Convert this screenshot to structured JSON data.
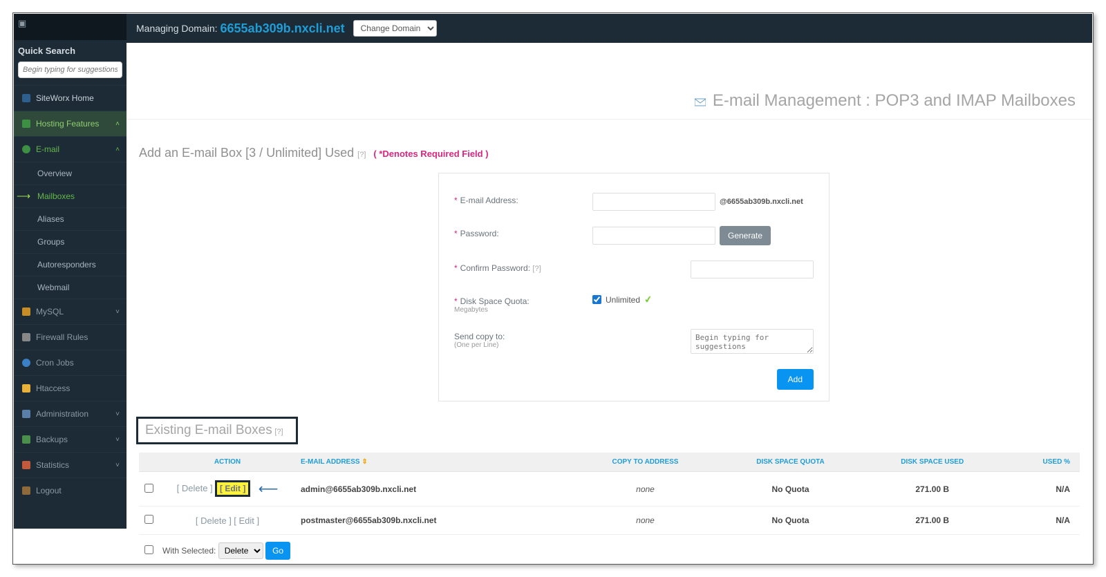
{
  "topbar": {
    "managing_label": "Managing Domain:",
    "domain": "6655ab309b.nxcli.net",
    "change_domain": "Change Domain"
  },
  "sidebar": {
    "quick_search_label": "Quick Search",
    "quick_search_placeholder": "Begin typing for suggestions",
    "home": "SiteWorx Home",
    "hosting": "Hosting Features",
    "email": "E-mail",
    "email_items": {
      "overview": "Overview",
      "mailboxes": "Mailboxes",
      "aliases": "Aliases",
      "groups": "Groups",
      "autoresponders": "Autoresponders",
      "webmail": "Webmail"
    },
    "mysql": "MySQL",
    "firewall": "Firewall Rules",
    "cron": "Cron Jobs",
    "htaccess": "Htaccess",
    "admin": "Administration",
    "backups": "Backups",
    "stats": "Statistics",
    "logout": "Logout"
  },
  "page": {
    "title": "E-mail Management : POP3 and IMAP Mailboxes",
    "add_title": "Add an E-mail Box [3 / Unlimited] Used",
    "required_note": "( *Denotes Required Field )"
  },
  "form": {
    "email_label": "E-mail Address:",
    "domain_suffix": "@6655ab309b.nxcli.net",
    "password_label": "Password:",
    "generate": "Generate",
    "confirm_label": "Confirm Password:",
    "quota_label": "Disk Space Quota:",
    "quota_sub": "Megabytes",
    "unlimited": "Unlimited",
    "copy_label": "Send copy to:",
    "copy_sub": "(One per Line)",
    "copy_placeholder": "Begin typing for suggestions",
    "add_btn": "Add",
    "help": "[?]"
  },
  "existing": {
    "title": "Existing E-mail Boxes",
    "cols": {
      "action": "ACTION",
      "email": "E-MAIL ADDRESS",
      "copy": "COPY TO ADDRESS",
      "quota": "DISK SPACE QUOTA",
      "used": "DISK SPACE USED",
      "pct": "USED %"
    },
    "delete_label": "[ Delete ]",
    "edit_label": "[ Edit ]",
    "rows": [
      {
        "email": "admin@6655ab309b.nxcli.net",
        "copy": "none",
        "quota": "No Quota",
        "used": "271.00 B",
        "pct": "N/A"
      },
      {
        "email": "postmaster@6655ab309b.nxcli.net",
        "copy": "none",
        "quota": "No Quota",
        "used": "271.00 B",
        "pct": "N/A"
      }
    ],
    "with_selected": "With Selected:",
    "ws_option": "Delete",
    "go": "Go"
  }
}
